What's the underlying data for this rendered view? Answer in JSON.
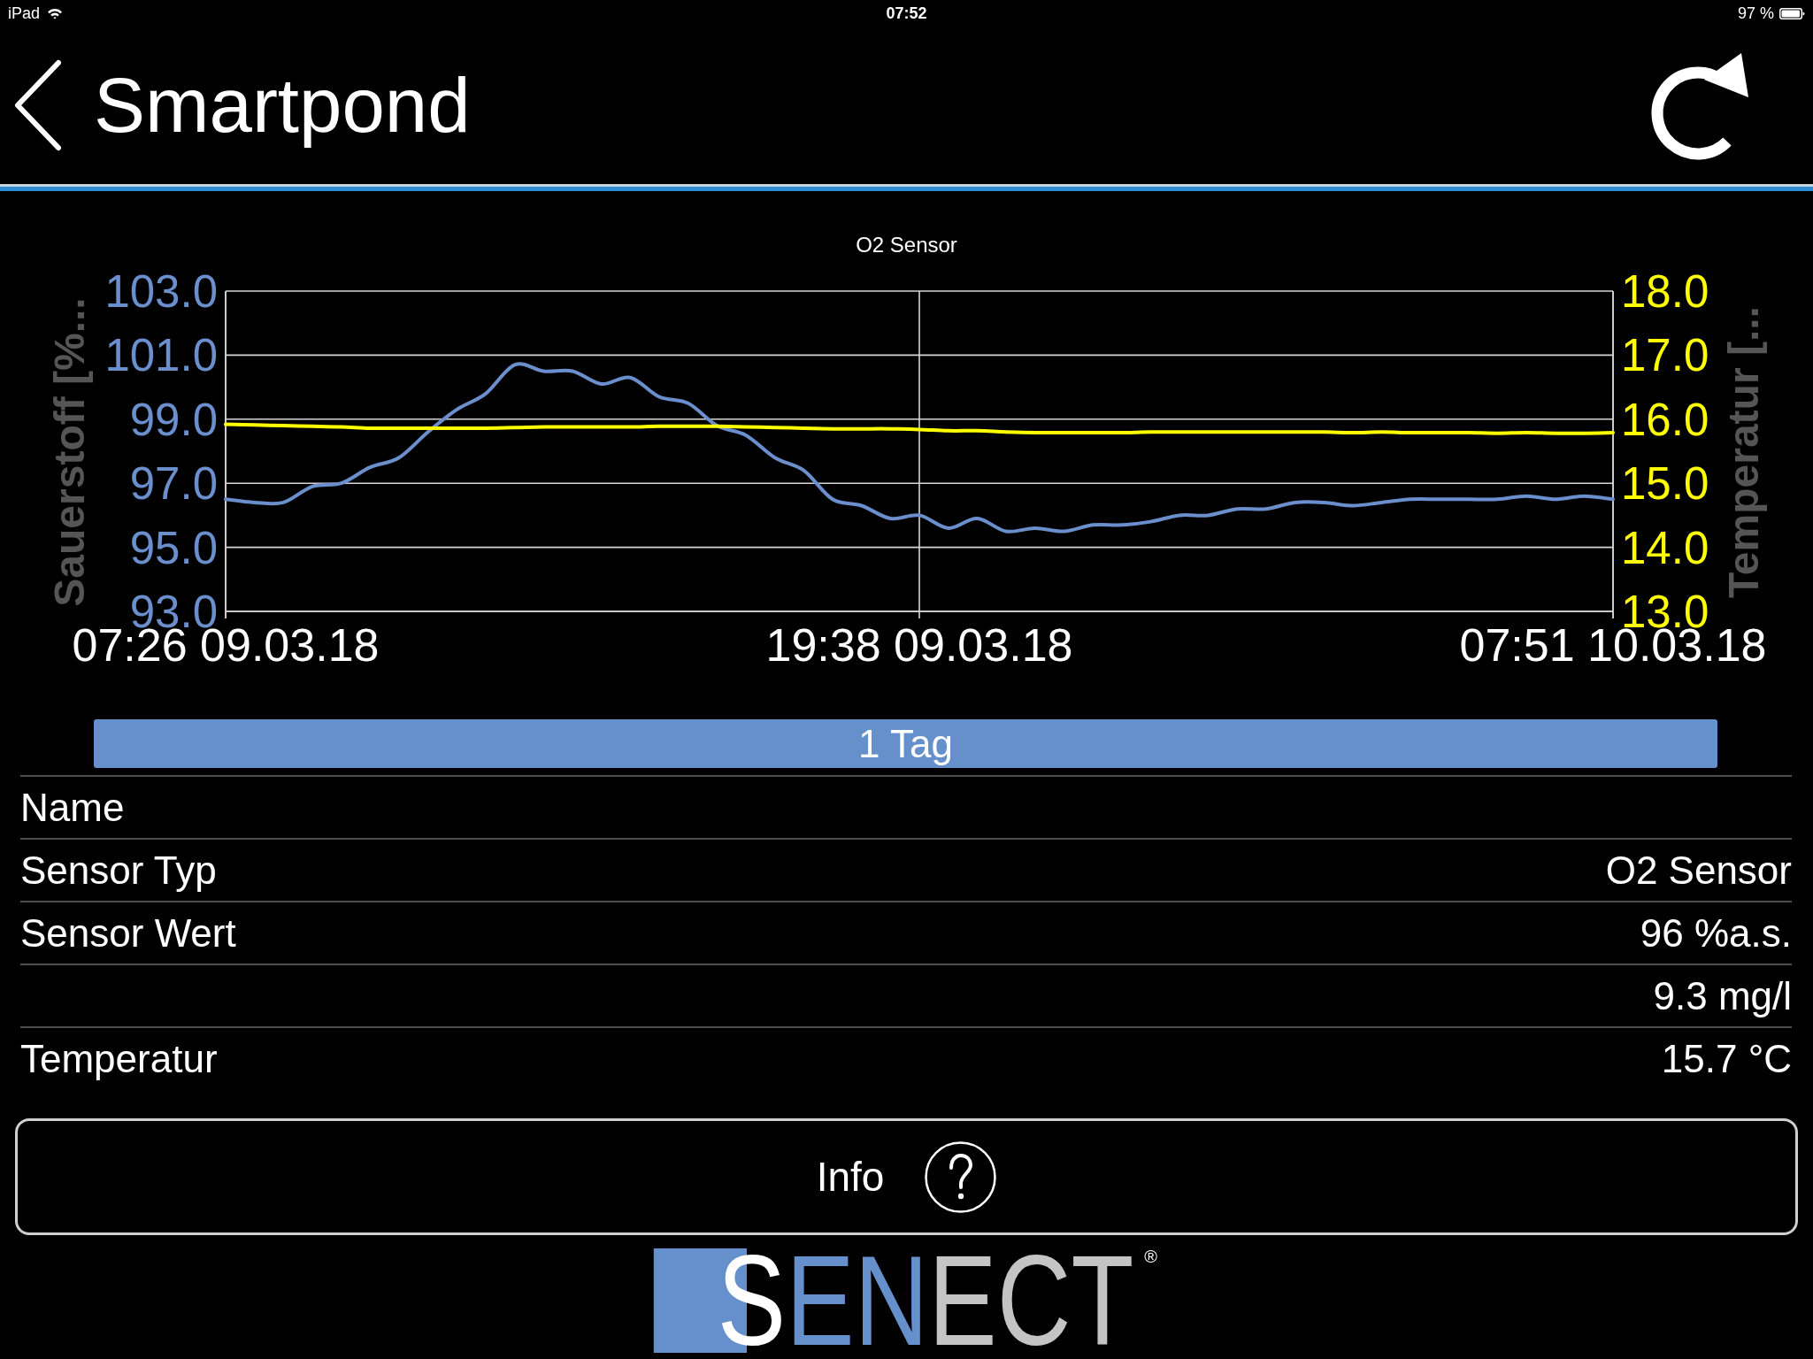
{
  "status_bar": {
    "device": "iPad",
    "time": "07:52",
    "battery": "97 %"
  },
  "header": {
    "title": "Smartpond"
  },
  "chart": {
    "chart_data": {
      "type": "line",
      "title": "O2 Sensor",
      "ylabel": "Sauerstoff [%...",
      "y2label": "Temperatur [...",
      "grid": true,
      "categories": [
        "07:26 09.03.18",
        null,
        null,
        null,
        null,
        null,
        null,
        null,
        null,
        null,
        null,
        null,
        null,
        null,
        null,
        null,
        null,
        null,
        null,
        null,
        null,
        null,
        null,
        null,
        "19:38 09.03.18",
        null,
        null,
        null,
        null,
        null,
        null,
        null,
        null,
        null,
        null,
        null,
        null,
        null,
        null,
        null,
        null,
        null,
        null,
        null,
        null,
        null,
        null,
        null,
        "07:51 10.03.18"
      ],
      "ylim": [
        93,
        103
      ],
      "yticks": [
        {
          "value": 93,
          "label": "93.0"
        },
        {
          "value": 95,
          "label": "95.0"
        },
        {
          "value": 97,
          "label": "97.0"
        },
        {
          "value": 99,
          "label": "99.0"
        },
        {
          "value": 101,
          "label": "101.0"
        },
        {
          "value": 103,
          "label": "103.0"
        }
      ],
      "y2lim": [
        13,
        18
      ],
      "y2ticks": [
        {
          "value": 13,
          "label": "13.0"
        },
        {
          "value": 14,
          "label": "14.0"
        },
        {
          "value": 15,
          "label": "15.0"
        },
        {
          "value": 16,
          "label": "16.0"
        },
        {
          "value": 17,
          "label": "17.0"
        },
        {
          "value": 18,
          "label": "18.0"
        }
      ],
      "series": [
        {
          "color": "#6b8fcd",
          "values": [
            96.5,
            96.4,
            96.4,
            96.9,
            97.0,
            97.5,
            97.8,
            98.6,
            99.3,
            99.8,
            100.7,
            100.5,
            100.5,
            100.1,
            100.3,
            99.7,
            99.5,
            98.8,
            98.5,
            97.8,
            97.4,
            96.5,
            96.3,
            95.9,
            96.0,
            95.6,
            95.9,
            95.5,
            95.6,
            95.5,
            95.7,
            95.7,
            95.8,
            96.0,
            96.0,
            96.2,
            96.2,
            96.4,
            96.4,
            96.3,
            96.4,
            96.5,
            96.5,
            96.5,
            96.5,
            96.6,
            96.5,
            96.6,
            96.5
          ]
        },
        {
          "color": "#ffff00",
          "axis": "y2",
          "values": [
            15.92,
            15.91,
            15.9,
            15.89,
            15.88,
            15.86,
            15.86,
            15.86,
            15.86,
            15.86,
            15.87,
            15.88,
            15.88,
            15.88,
            15.88,
            15.89,
            15.89,
            15.89,
            15.88,
            15.87,
            15.86,
            15.85,
            15.85,
            15.85,
            15.84,
            15.82,
            15.82,
            15.8,
            15.79,
            15.79,
            15.79,
            15.79,
            15.8,
            15.8,
            15.8,
            15.8,
            15.8,
            15.8,
            15.8,
            15.79,
            15.8,
            15.79,
            15.79,
            15.79,
            15.78,
            15.79,
            15.78,
            15.78,
            15.79
          ]
        }
      ]
    }
  },
  "range_selector": [
    {
      "label": "1 Tag",
      "selected": true
    }
  ],
  "details": [
    {
      "label": "Name"
    },
    {
      "label": "Sensor Typ",
      "value": "O2 Sensor"
    },
    {
      "label": "Sensor Wert",
      "value": "96 %a.s."
    },
    {
      "value": "9.3 mg/l"
    },
    {
      "label": "Temperatur",
      "value": "15.7 °C"
    }
  ],
  "info_button": {
    "label": "Info"
  },
  "logo": {
    "segments": [
      {
        "text": "S",
        "kind": "boxed"
      },
      {
        "text": "EN",
        "kind": "blue"
      },
      {
        "text": "ECT",
        "kind": "gray"
      }
    ],
    "mark": "®"
  }
}
